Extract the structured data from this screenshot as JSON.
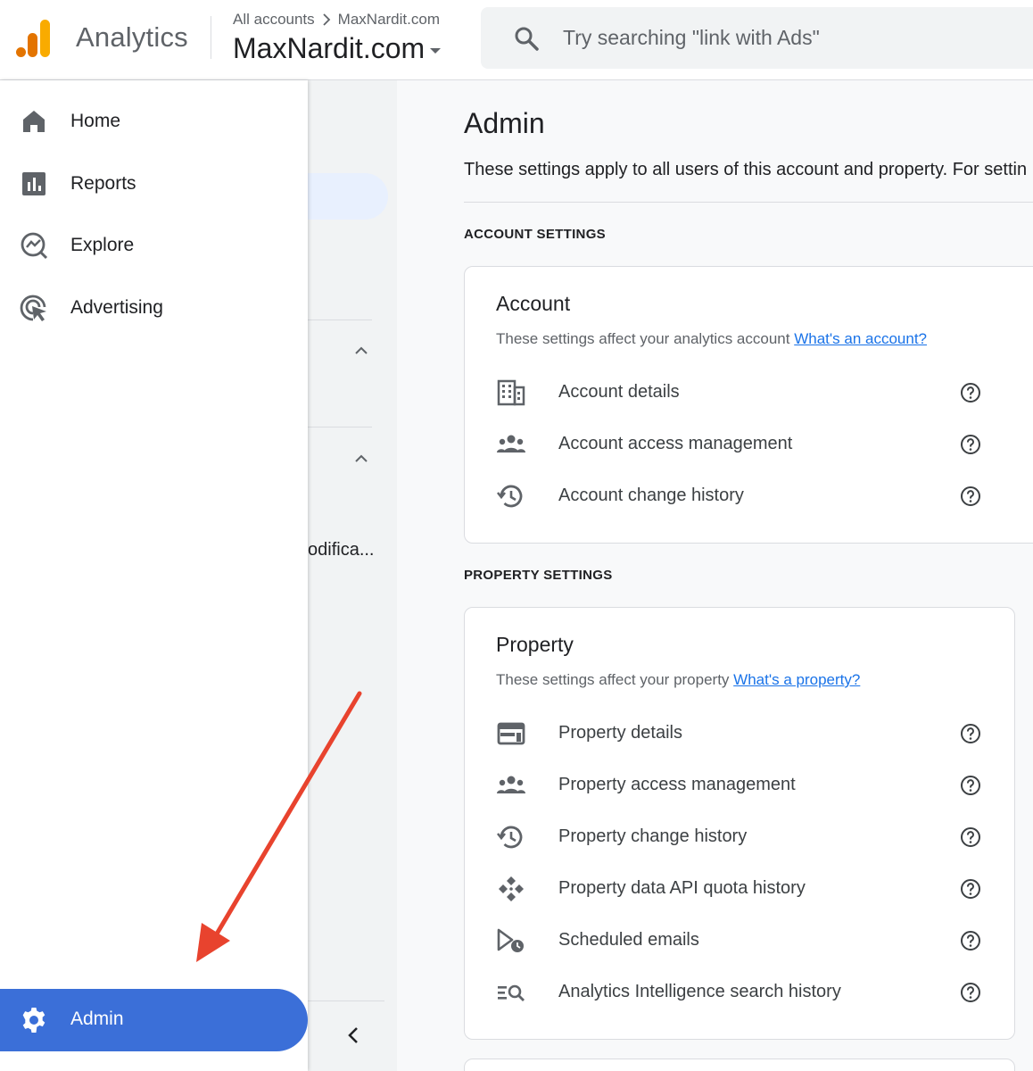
{
  "header": {
    "app_name": "Analytics",
    "breadcrumb_account": "All accounts",
    "breadcrumb_property": "MaxNardit.com",
    "property_selector": "MaxNardit.com",
    "search_placeholder": "Try searching \"link with Ads\""
  },
  "drawer": {
    "items": [
      {
        "label": "Home",
        "icon": "home-icon"
      },
      {
        "label": "Reports",
        "icon": "reports-icon"
      },
      {
        "label": "Explore",
        "icon": "explore-icon"
      },
      {
        "label": "Advertising",
        "icon": "advertising-icon"
      }
    ],
    "admin_label": "Admin",
    "admin_icon": "gear-icon"
  },
  "background_nav": {
    "truncated_text": "odifica..."
  },
  "main": {
    "title": "Admin",
    "description": "These settings apply to all users of this account and property. For settin",
    "account_section_header": "ACCOUNT SETTINGS",
    "account_card": {
      "title": "Account",
      "description": "These settings affect your analytics account",
      "link": "What's an account?",
      "rows": [
        {
          "label": "Account details",
          "icon": "building-icon"
        },
        {
          "label": "Account access management",
          "icon": "people-icon"
        },
        {
          "label": "Account change history",
          "icon": "history-icon"
        }
      ]
    },
    "property_section_header": "PROPERTY SETTINGS",
    "property_card": {
      "title": "Property",
      "description": "These settings affect your property",
      "link": "What's a property?",
      "rows": [
        {
          "label": "Property details",
          "icon": "web-icon"
        },
        {
          "label": "Property access management",
          "icon": "people-icon"
        },
        {
          "label": "Property change history",
          "icon": "history-icon"
        },
        {
          "label": "Property data API quota history",
          "icon": "api-icon"
        },
        {
          "label": "Scheduled emails",
          "icon": "scheduled-email-icon"
        },
        {
          "label": "Analytics Intelligence search history",
          "icon": "search-history-icon"
        }
      ]
    }
  },
  "colors": {
    "accent": "#3b6fd8",
    "link": "#1a73e8",
    "arrow": "#e8432e",
    "logo_orange": "#f9ab00",
    "logo_dark_orange": "#e37400"
  }
}
